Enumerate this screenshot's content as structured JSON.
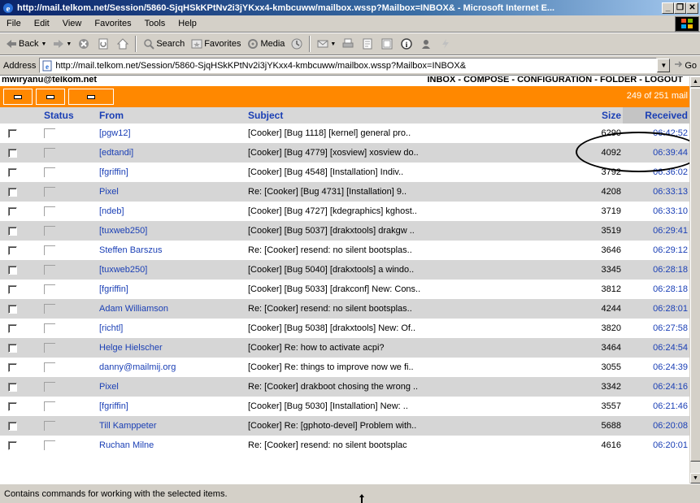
{
  "window": {
    "title": "http://mail.telkom.net/Session/5860-SjqHSkKPtNv2i3jYKxx4-kmbcuww/mailbox.wssp?Mailbox=INBOX& - Microsoft Internet E...",
    "min_label": "_",
    "max_label": "❐",
    "close_label": "✕"
  },
  "menu": {
    "items": [
      {
        "label": "File"
      },
      {
        "label": "Edit"
      },
      {
        "label": "View"
      },
      {
        "label": "Favorites"
      },
      {
        "label": "Tools"
      },
      {
        "label": "Help"
      }
    ]
  },
  "toolbar": {
    "back_label": "Back",
    "search_label": "Search",
    "favorites_label": "Favorites",
    "media_label": "Media"
  },
  "address": {
    "label": "Address",
    "url": "http://mail.telkom.net/Session/5860-SjqHSkKPtNv2i3jYKxx4-kmbcuww/mailbox.wssp?Mailbox=INBOX&",
    "go_label": "Go"
  },
  "mail": {
    "account": "mwiryanu@telkom.net",
    "nav": "INBOX - COMPOSE - CONFIGURATION - FOLDER - LOGOUT",
    "count": "249 of 251 mail",
    "columns": {
      "status": "Status",
      "from": "From",
      "subject": "Subject",
      "size": "Size",
      "received": "Received"
    },
    "messages": [
      {
        "from": "[pgw12]",
        "subject": "[Cooker] [Bug 1118] [kernel] general pro..",
        "size": "6290",
        "received": "06:42:52"
      },
      {
        "from": "[edtandi]",
        "subject": "[Cooker] [Bug 4779] [xosview] xosview do..",
        "size": "4092",
        "received": "06:39:44"
      },
      {
        "from": "[fgriffin]",
        "subject": "[Cooker] [Bug 4548] [Installation] Indiv..",
        "size": "3792",
        "received": "06:36:02"
      },
      {
        "from": "Pixel",
        "subject": "Re: [Cooker] [Bug 4731] [Installation] 9..",
        "size": "4208",
        "received": "06:33:13"
      },
      {
        "from": "[ndeb]",
        "subject": "[Cooker] [Bug 4727] [kdegraphics] kghost..",
        "size": "3719",
        "received": "06:33:10"
      },
      {
        "from": "[tuxweb250]",
        "subject": "[Cooker] [Bug 5037] [drakxtools] drakgw ..",
        "size": "3519",
        "received": "06:29:41"
      },
      {
        "from": "Steffen Barszus",
        "subject": "Re: [Cooker] resend: no silent bootsplas..",
        "size": "3646",
        "received": "06:29:12"
      },
      {
        "from": "[tuxweb250]",
        "subject": "[Cooker] [Bug 5040] [drakxtools] a windo..",
        "size": "3345",
        "received": "06:28:18"
      },
      {
        "from": "[fgriffin]",
        "subject": "[Cooker] [Bug 5033] [drakconf] New: Cons..",
        "size": "3812",
        "received": "06:28:18"
      },
      {
        "from": "Adam Williamson",
        "subject": "Re: [Cooker] resend: no silent bootsplas..",
        "size": "4244",
        "received": "06:28:01"
      },
      {
        "from": "[richtl]",
        "subject": "[Cooker] [Bug 5038] [drakxtools] New: Of..",
        "size": "3820",
        "received": "06:27:58"
      },
      {
        "from": "Helge Hielscher",
        "subject": "[Cooker] Re: how to activate acpi?",
        "size": "3464",
        "received": "06:24:54"
      },
      {
        "from": "danny@mailmij.org",
        "subject": "[Cooker] Re: things to improve now we fi..",
        "size": "3055",
        "received": "06:24:39"
      },
      {
        "from": "Pixel",
        "subject": "Re: [Cooker] drakboot chosing the wrong ..",
        "size": "3342",
        "received": "06:24:16"
      },
      {
        "from": "[fgriffin]",
        "subject": "[Cooker] [Bug 5030] [Installation] New: ..",
        "size": "3557",
        "received": "06:21:46"
      },
      {
        "from": "Till Kamppeter",
        "subject": "[Cooker] Re: [gphoto-devel] Problem with..",
        "size": "5688",
        "received": "06:20:08"
      },
      {
        "from": "Ruchan Milne",
        "subject": "Re: [Cooker] resend: no silent bootsplac",
        "size": "4616",
        "received": "06:20:01"
      }
    ]
  },
  "statusbar": {
    "text": "Contains commands for working with the selected items."
  }
}
